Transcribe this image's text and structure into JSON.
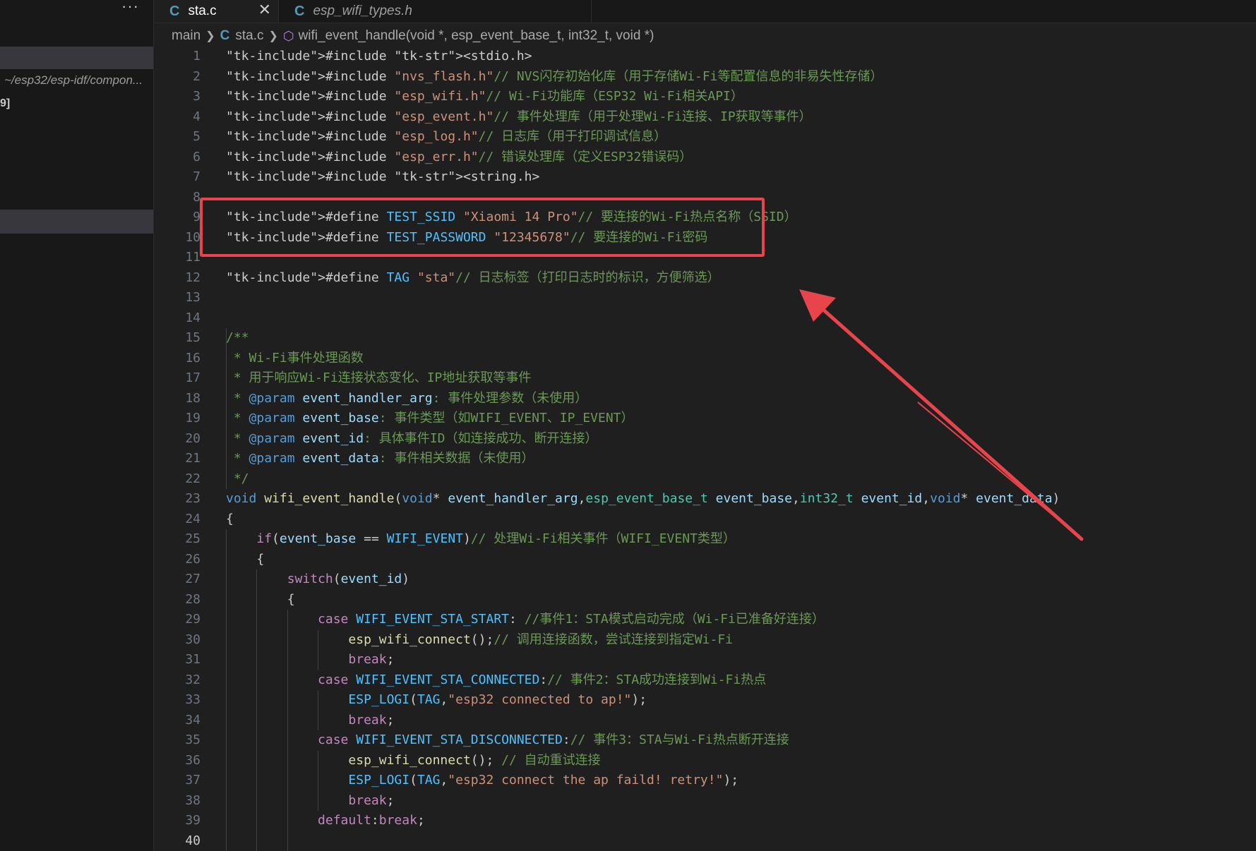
{
  "sidebar": {
    "more_label": "···",
    "path_text": "~/esp32/esp-idf/compon...",
    "fragment_text": "9]"
  },
  "tabs": [
    {
      "icon": "C",
      "label": "sta.c",
      "close": "✕"
    },
    {
      "icon": "C",
      "label": "esp_wifi_types.h"
    }
  ],
  "breadcrumb": {
    "folder": "main",
    "file_icon": "C",
    "file": "sta.c",
    "symbol": "wifi_event_handle(void *, esp_event_base_t, int32_t, void *)"
  },
  "editor": {
    "current_line": "40",
    "lines": [
      {
        "n": "1",
        "text": "#include <stdio.h>"
      },
      {
        "n": "2",
        "text": "#include \"nvs_flash.h\"// NVS闪存初始化库（用于存储Wi-Fi等配置信息的非易失性存储）"
      },
      {
        "n": "3",
        "text": "#include \"esp_wifi.h\"// Wi-Fi功能库（ESP32 Wi-Fi相关API）"
      },
      {
        "n": "4",
        "text": "#include \"esp_event.h\"// 事件处理库（用于处理Wi-Fi连接、IP获取等事件）"
      },
      {
        "n": "5",
        "text": "#include \"esp_log.h\"// 日志库（用于打印调试信息）"
      },
      {
        "n": "6",
        "text": "#include \"esp_err.h\"// 错误处理库（定义ESP32错误码）"
      },
      {
        "n": "7",
        "text": "#include <string.h>"
      },
      {
        "n": "8",
        "text": ""
      },
      {
        "n": "9",
        "text": "#define TEST_SSID \"Xiaomi 14 Pro\"// 要连接的Wi-Fi热点名称（SSID）"
      },
      {
        "n": "10",
        "text": "#define TEST_PASSWORD \"12345678\"// 要连接的Wi-Fi密码"
      },
      {
        "n": "11",
        "text": ""
      },
      {
        "n": "12",
        "text": "#define TAG \"sta\"// 日志标签（打印日志时的标识，方便筛选）"
      },
      {
        "n": "13",
        "text": ""
      },
      {
        "n": "14",
        "text": ""
      },
      {
        "n": "15",
        "text": "/**"
      },
      {
        "n": "16",
        "text": " * Wi-Fi事件处理函数"
      },
      {
        "n": "17",
        "text": " * 用于响应Wi-Fi连接状态变化、IP地址获取等事件"
      },
      {
        "n": "18",
        "text": " * @param event_handler_arg: 事件处理参数（未使用）"
      },
      {
        "n": "19",
        "text": " * @param event_base: 事件类型（如WIFI_EVENT、IP_EVENT）"
      },
      {
        "n": "20",
        "text": " * @param event_id: 具体事件ID（如连接成功、断开连接）"
      },
      {
        "n": "21",
        "text": " * @param event_data: 事件相关数据（未使用）"
      },
      {
        "n": "22",
        "text": " */"
      },
      {
        "n": "23",
        "text": "void wifi_event_handle(void* event_handler_arg,esp_event_base_t event_base,int32_t event_id,void* event_data)"
      },
      {
        "n": "24",
        "text": "{"
      },
      {
        "n": "25",
        "text": "    if(event_base == WIFI_EVENT)// 处理Wi-Fi相关事件（WIFI_EVENT类型）"
      },
      {
        "n": "26",
        "text": "    {"
      },
      {
        "n": "27",
        "text": "        switch(event_id)"
      },
      {
        "n": "28",
        "text": "        {"
      },
      {
        "n": "29",
        "text": "            case WIFI_EVENT_STA_START: //事件1：STA模式启动完成（Wi-Fi已准备好连接）"
      },
      {
        "n": "30",
        "text": "                esp_wifi_connect();// 调用连接函数，尝试连接到指定Wi-Fi"
      },
      {
        "n": "31",
        "text": "                break;"
      },
      {
        "n": "32",
        "text": "            case WIFI_EVENT_STA_CONNECTED:// 事件2：STA成功连接到Wi-Fi热点"
      },
      {
        "n": "33",
        "text": "                ESP_LOGI(TAG,\"esp32 connected to ap!\");"
      },
      {
        "n": "34",
        "text": "                break;"
      },
      {
        "n": "35",
        "text": "            case WIFI_EVENT_STA_DISCONNECTED:// 事件3：STA与Wi-Fi热点断开连接"
      },
      {
        "n": "36",
        "text": "                esp_wifi_connect(); // 自动重试连接"
      },
      {
        "n": "37",
        "text": "                ESP_LOGI(TAG,\"esp32 connect the ap faild! retry!\");"
      },
      {
        "n": "38",
        "text": "                break;"
      },
      {
        "n": "39",
        "text": "            default:break;"
      },
      {
        "n": "40",
        "text": ""
      }
    ]
  },
  "colors": {
    "highlight_box": "#e8444c",
    "arrow": "#e8444c"
  }
}
